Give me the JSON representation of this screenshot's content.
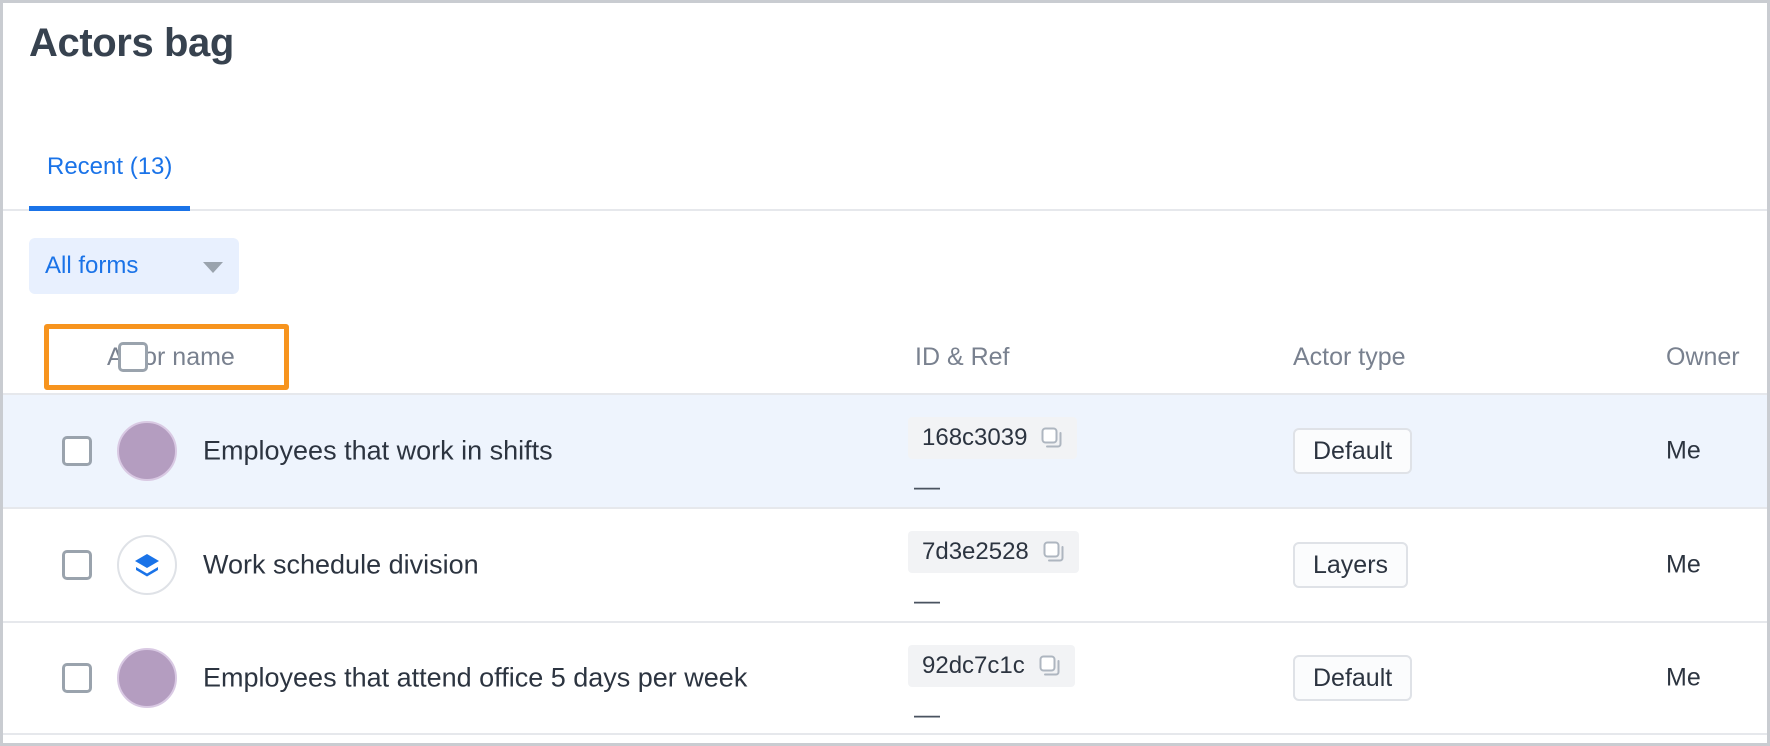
{
  "window": {
    "title": "Actors bag"
  },
  "tabs": [
    {
      "label": "Recent (13)",
      "active": true
    }
  ],
  "filter": {
    "label": "All forms",
    "caret_icon": "chevron-down-icon"
  },
  "table": {
    "columns": {
      "name": "Actor name",
      "id": "ID & Ref",
      "type": "Actor type",
      "owner": "Owner"
    },
    "rows": [
      {
        "name": "Employees that work in shifts",
        "avatar": "person-avatar",
        "avatar_color": "#b49dc0",
        "id": "168c3039",
        "copy_icon": "copy-icon",
        "ref": "—",
        "type": "Default",
        "owner": "Me",
        "highlighted": true
      },
      {
        "name": "Work schedule division",
        "avatar": "layers-icon",
        "avatar_color": "#1a73e8",
        "id": "7d3e2528",
        "copy_icon": "copy-icon",
        "ref": "—",
        "type": "Layers",
        "owner": "Me",
        "highlighted": false
      },
      {
        "name": "Employees that attend office 5 days per week",
        "avatar": "person-avatar",
        "avatar_color": "#b49dc0",
        "id": "92dc7c1c",
        "copy_icon": "copy-icon",
        "ref": "—",
        "type": "Default",
        "owner": "Me",
        "highlighted": false
      }
    ]
  },
  "annotation": {
    "target": "select-all-and-actor-name-header",
    "color": "#f7941e"
  },
  "colors": {
    "accent_blue": "#1a73e8",
    "tab_underline": "#1a73e8",
    "filter_bg": "#e8f0fe",
    "row_highlight": "#eef4fd",
    "header_text": "#79818f",
    "title_text": "#37424f"
  }
}
